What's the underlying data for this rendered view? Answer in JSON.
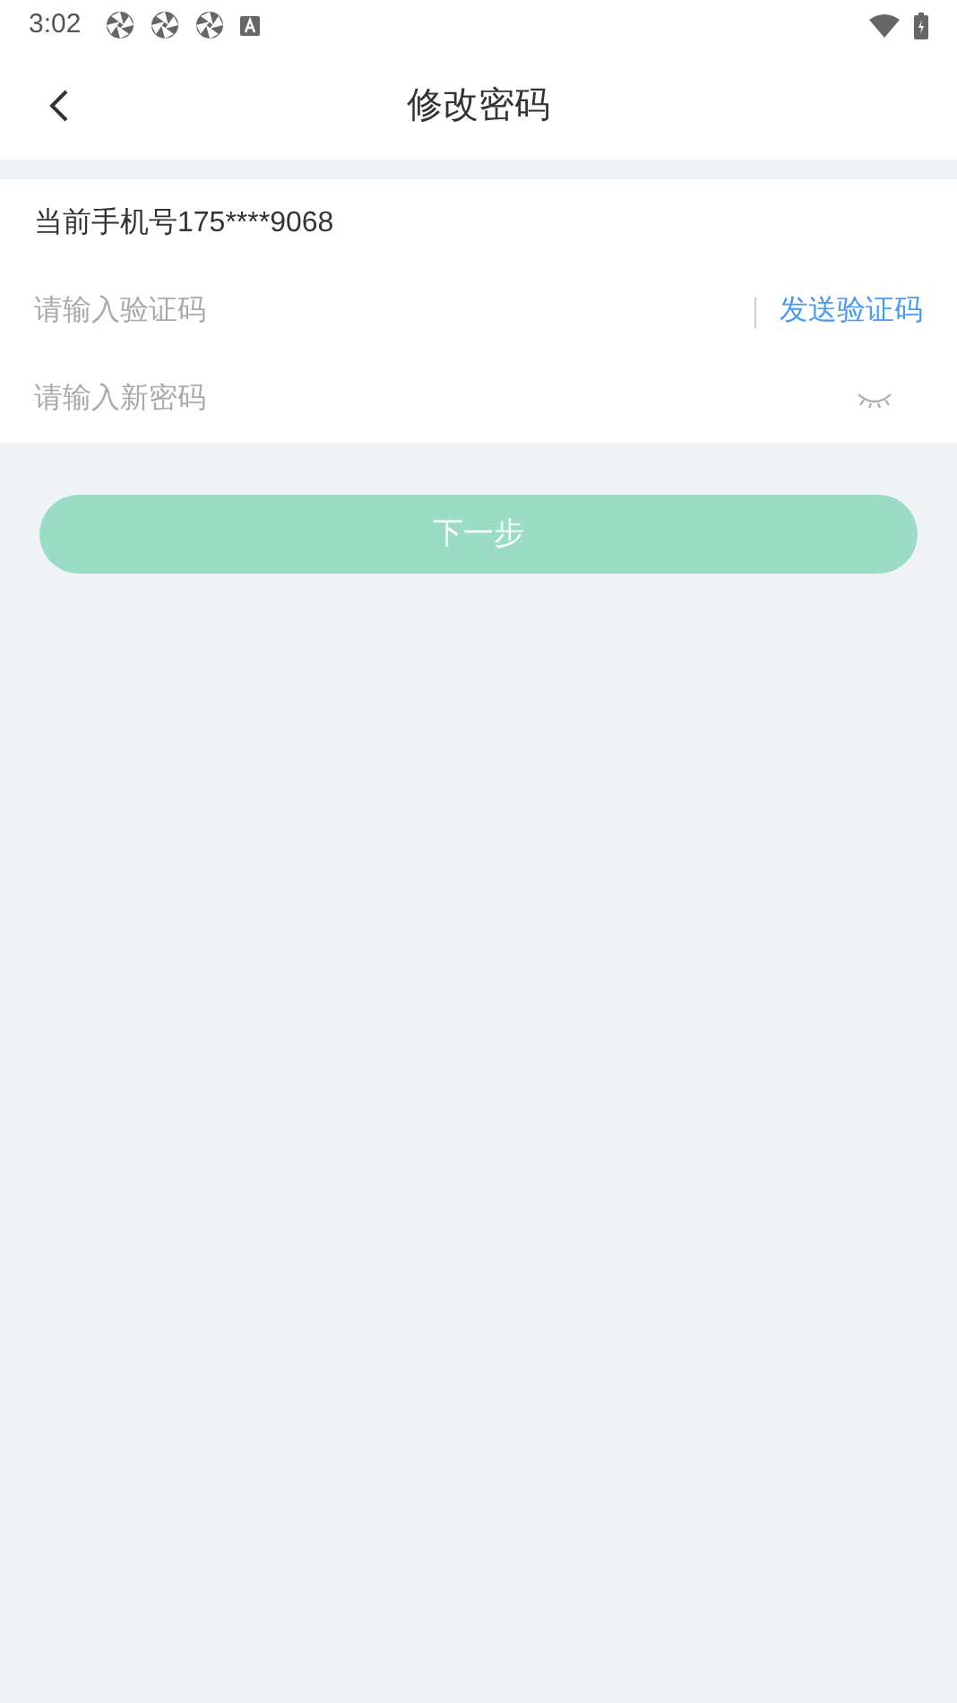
{
  "status_bar": {
    "time": "3:02"
  },
  "header": {
    "title": "修改密码"
  },
  "phone": {
    "label": "当前手机号175****9068"
  },
  "code_field": {
    "placeholder": "请输入验证码",
    "send_link": "发送验证码"
  },
  "password_field": {
    "placeholder": "请输入新密码",
    "visible": false
  },
  "next_button": {
    "label": "下一步",
    "disabled": true
  }
}
